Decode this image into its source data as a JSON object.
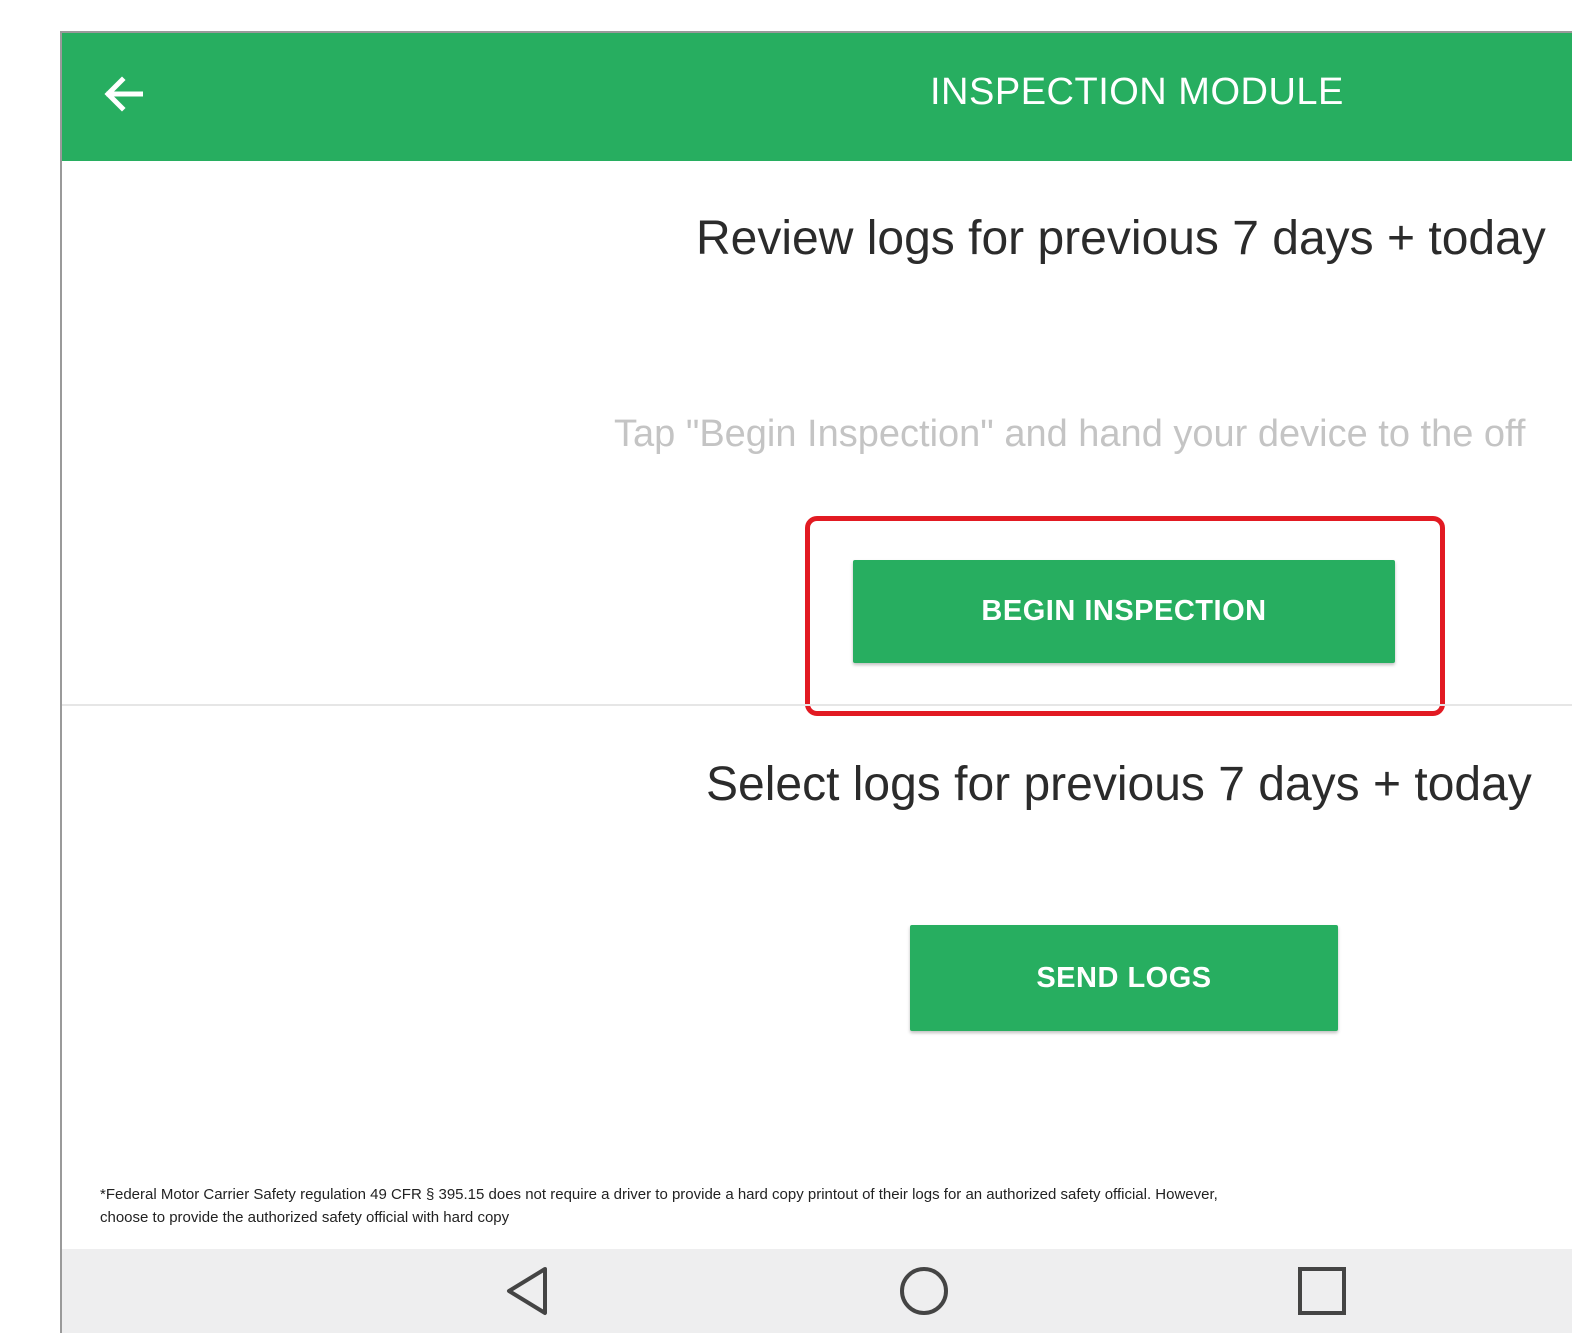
{
  "appbar": {
    "title": "INSPECTION MODULE",
    "back_icon": "arrow-left-icon"
  },
  "inspection": {
    "heading": "Review logs for previous 7 days + today",
    "hint": "Tap \"Begin Inspection\" and hand your device to the off",
    "button_label": "BEGIN INSPECTION"
  },
  "send": {
    "heading": "Select logs for previous 7 days + today",
    "button_label": "SEND LOGS"
  },
  "footnote": {
    "line1": "*Federal Motor Carrier Safety regulation 49 CFR § 395.15 does not require a driver to provide a hard copy printout of their logs for an authorized safety official. However,",
    "line2": "choose to provide the authorized safety official with hard copy"
  },
  "navbar": {
    "icons": [
      "back-triangle-icon",
      "home-circle-icon",
      "recents-square-icon"
    ]
  },
  "colors": {
    "brand_green": "#27ae60",
    "highlight_red": "#e21a22",
    "nav_background": "#eeeeef"
  }
}
